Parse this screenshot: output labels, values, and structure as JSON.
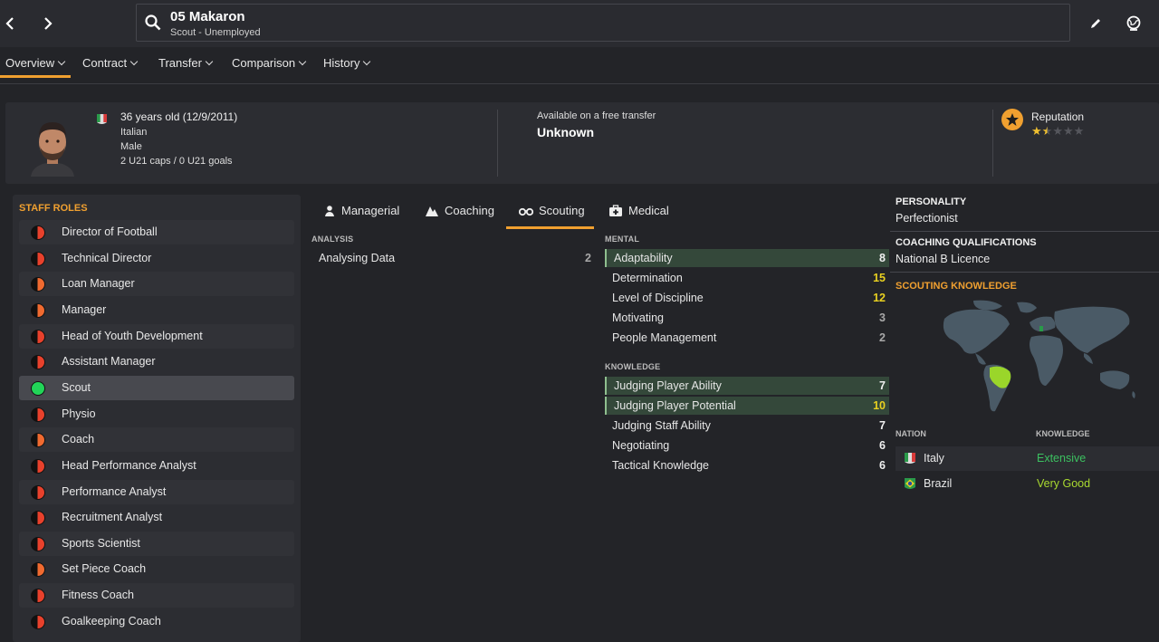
{
  "header": {
    "name": "05 Makaron",
    "subtitle": "Scout - Unemployed"
  },
  "tabs": [
    {
      "label": "Overview"
    },
    {
      "label": "Contract"
    },
    {
      "label": "Transfer"
    },
    {
      "label": "Comparison"
    },
    {
      "label": "History"
    }
  ],
  "profile": {
    "age": "36 years old (12/9/2011)",
    "nationality": "Italian",
    "gender": "Male",
    "caps": "2 U21 caps / 0 U21 goals",
    "transfer_label": "Available on a free transfer",
    "transfer_value": "Unknown",
    "reputation_label": "Reputation",
    "reputation_stars": 1.5,
    "reputation_max": 5
  },
  "staff_roles": {
    "title": "STAFF ROLES",
    "items": [
      {
        "label": "Director of Football",
        "color": "#e8412c"
      },
      {
        "label": "Technical Director",
        "color": "#e8412c"
      },
      {
        "label": "Loan Manager",
        "color": "#f06a30"
      },
      {
        "label": "Manager",
        "color": "#f06a30"
      },
      {
        "label": "Head of Youth Development",
        "color": "#e8412c"
      },
      {
        "label": "Assistant Manager",
        "color": "#e8412c"
      },
      {
        "label": "Scout",
        "color": "#22d458"
      },
      {
        "label": "Physio",
        "color": "#e8412c"
      },
      {
        "label": "Coach",
        "color": "#f06a30"
      },
      {
        "label": "Head Performance Analyst",
        "color": "#e8412c"
      },
      {
        "label": "Performance Analyst",
        "color": "#e8412c"
      },
      {
        "label": "Recruitment Analyst",
        "color": "#e8412c"
      },
      {
        "label": "Sports Scientist",
        "color": "#e8412c"
      },
      {
        "label": "Set Piece Coach",
        "color": "#f06a30"
      },
      {
        "label": "Fitness Coach",
        "color": "#e8412c"
      },
      {
        "label": "Goalkeeping Coach",
        "color": "#e8412c"
      }
    ]
  },
  "attr_tabs": [
    {
      "label": "Managerial",
      "icon": "managerial-icon"
    },
    {
      "label": "Coaching",
      "icon": "coaching-icon"
    },
    {
      "label": "Scouting",
      "icon": "binoculars-icon"
    },
    {
      "label": "Medical",
      "icon": "medical-kit-icon"
    }
  ],
  "analysis": {
    "title": "ANALYSIS",
    "items": [
      {
        "name": "Analysing Data",
        "value": "2"
      }
    ]
  },
  "mental": {
    "title": "MENTAL",
    "items": [
      {
        "name": "Adaptability",
        "value": "8"
      },
      {
        "name": "Determination",
        "value": "15"
      },
      {
        "name": "Level of Discipline",
        "value": "12"
      },
      {
        "name": "Motivating",
        "value": "3"
      },
      {
        "name": "People Management",
        "value": "2"
      }
    ]
  },
  "knowledge": {
    "title": "KNOWLEDGE",
    "items": [
      {
        "name": "Judging Player Ability",
        "value": "7"
      },
      {
        "name": "Judging Player Potential",
        "value": "10"
      },
      {
        "name": "Judging Staff Ability",
        "value": "7"
      },
      {
        "name": "Negotiating",
        "value": "6"
      },
      {
        "name": "Tactical Knowledge",
        "value": "6"
      }
    ]
  },
  "right": {
    "personality_title": "PERSONALITY",
    "personality_value": "Perfectionist",
    "coaching_title": "COACHING QUALIFICATIONS",
    "coaching_value": "National B Licence",
    "scouting_title": "SCOUTING KNOWLEDGE",
    "nation_hdr": "NATION",
    "knowledge_hdr": "KNOWLEDGE",
    "nations": [
      {
        "nation": "Italy",
        "level": "Extensive",
        "color": "#3cc060"
      },
      {
        "nation": "Brazil",
        "level": "Very Good",
        "color": "#a8d830"
      }
    ]
  },
  "colors": {
    "accent": "#f0a030",
    "highlight_row": "#34483a"
  }
}
